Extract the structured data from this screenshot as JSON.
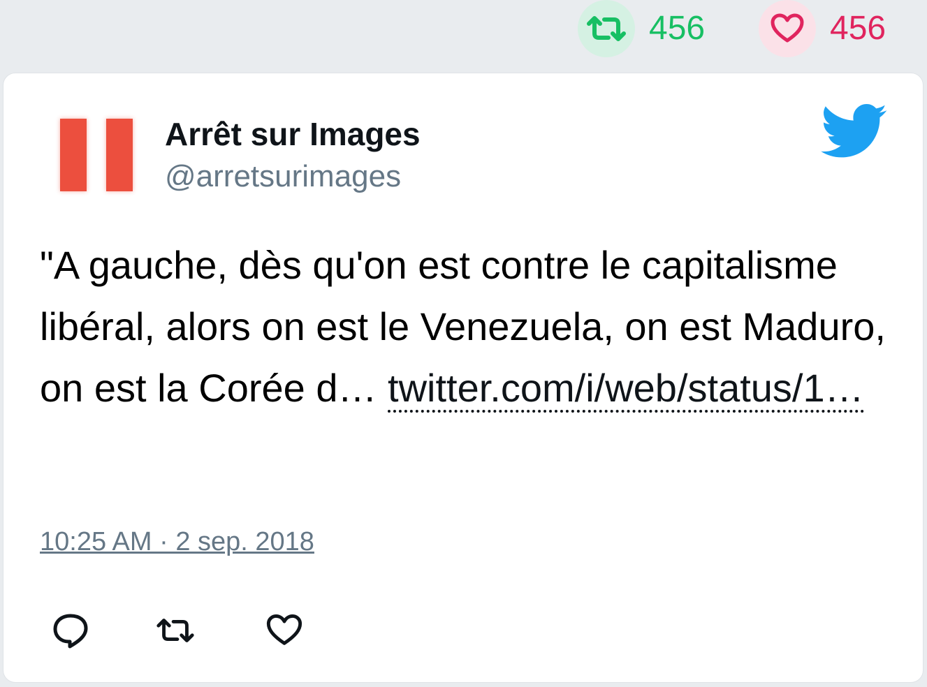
{
  "top_stats": {
    "retweet_icon": "retweet-icon",
    "retweet_count": "456",
    "retweet_color": "#17bf63",
    "like_icon": "heart-icon",
    "like_count": "456",
    "like_color": "#e0245e"
  },
  "tweet": {
    "author_name": "Arrêt sur Images",
    "author_handle": "@arretsurimages",
    "avatar_icon": "pause-logo",
    "brand_icon": "twitter-bird-icon",
    "brand_color": "#1da1f2",
    "text": "\"A gauche, dès qu'on est contre le capitalisme libéral, alors on est le Venezuela, on est Maduro, on est la Corée d… ",
    "link_text": "twitter.com/i/web/status/1…",
    "timestamp": "10:25 AM · 2 sep. 2018"
  },
  "actions": {
    "reply_icon": "reply-icon",
    "retweet_icon": "retweet-icon",
    "like_icon": "heart-icon"
  }
}
